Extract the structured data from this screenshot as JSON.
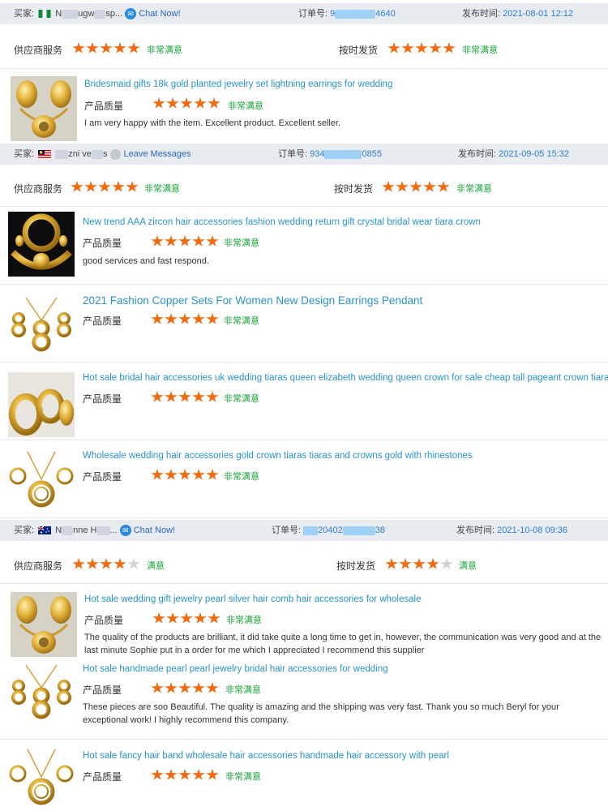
{
  "labels": {
    "buyer": "买家:",
    "order": "订单号:",
    "published": "发布时间:",
    "supplier_service": "供应商服务",
    "on_time_shipping": "按时发货",
    "product_quality": "产品质量",
    "chat_now": "Chat Now!",
    "leave_messages": "Leave Messages"
  },
  "colors": {
    "star": "#f26a10",
    "star_off": "#cfd2d6",
    "satisfied": "#1aa33a",
    "link": "#2a93c9",
    "header_bg": "#e8ebf0"
  },
  "reviews": [
    {
      "buyer_name_visible": [
        "N",
        "ugw",
        "sp..."
      ],
      "buyer_flag": "Nigeria",
      "contact": "Chat Now!",
      "order_visible": [
        "9",
        "4640"
      ],
      "date": "2021-08-01 12:12",
      "service_rating": 5,
      "service_text": "非常满意",
      "shipping_rating": 5,
      "shipping_text": "非常满意",
      "products": [
        {
          "title": "Bridesmaid gifts 18k gold planted jewelry set lightning earrings for wedding",
          "rating": 5,
          "rating_text": "非常满意",
          "comment": "I am very happy with the item. Excellent product. Excellent seller.",
          "thumb": "gold-necklace-set"
        }
      ]
    },
    {
      "buyer_name_visible": [
        "",
        "zni ve",
        "s"
      ],
      "buyer_flag": "Malaysia",
      "contact": "Leave Messages",
      "order_visible": [
        "934",
        "0855"
      ],
      "date": "2021-09-05 15:32",
      "service_rating": 5,
      "service_text": "非常满意",
      "shipping_rating": 5,
      "shipping_text": "非常满意",
      "products": [
        {
          "title": "New trend AAA zircon hair accessories fashion wedding return gift crystal bridal wear tiara crown",
          "rating": 5,
          "rating_text": "非常满意",
          "comment": "good services and fast respond.",
          "thumb": "gold-bracelet-set"
        },
        {
          "title": "2021 Fashion Copper Sets For Women New Design Earrings Pendant",
          "rating": 5,
          "rating_text": "非常满意",
          "comment": "",
          "thumb": "gold-figure-eight-set"
        },
        {
          "title": "Hot sale bridal hair accessories uk wedding tiaras queen elizabeth wedding queen crown for sale cheap tall pageant crown tiara",
          "rating": 5,
          "rating_text": "非常满意",
          "comment": "",
          "thumb": "gold-bangles"
        },
        {
          "title": "Wholesale wedding hair accessories gold crown tiaras tiaras and crowns gold with rhinestones",
          "rating": 5,
          "rating_text": "非常满意",
          "comment": "",
          "thumb": "gold-hoop-set"
        }
      ]
    },
    {
      "buyer_name_visible": [
        "N",
        "nne H",
        "..."
      ],
      "buyer_flag": "Australia",
      "contact": "Chat Now!",
      "order_visible": [
        "20402",
        "38"
      ],
      "date": "2021-10-08 09:36",
      "service_rating": 4,
      "service_text": "满意",
      "shipping_rating": 4,
      "shipping_text": "满意",
      "products": [
        {
          "title": "Hot sale wedding gift jewelry pearl silver hair comb hair accessories for wholesale",
          "rating": 5,
          "rating_text": "非常满意",
          "comment": "The quality of the products are brilliant, it did take quite a long time to get in, however, the communication was very good and at the last minute Sophie put in a order for me which I appreciated I recommend this supplier",
          "thumb": "gold-necklace-set"
        },
        {
          "title": "Hot sale handmade pearl pearl jewelry bridal hair accessories for wedding",
          "rating": 5,
          "rating_text": "非常满意",
          "comment": "These pieces are soo Beautiful. The quality is amazing and the shipping was very fast. Thank you so much Beryl for your exceptional work! I highly recommend this company.",
          "thumb": "gold-figure-eight-set"
        },
        {
          "title": "Hot sale fancy hair band wholesale hair accessories handmade hair accessory with pearl",
          "rating": 5,
          "rating_text": "非常满意",
          "comment": "",
          "thumb": "gold-hoop-set"
        }
      ]
    }
  ]
}
